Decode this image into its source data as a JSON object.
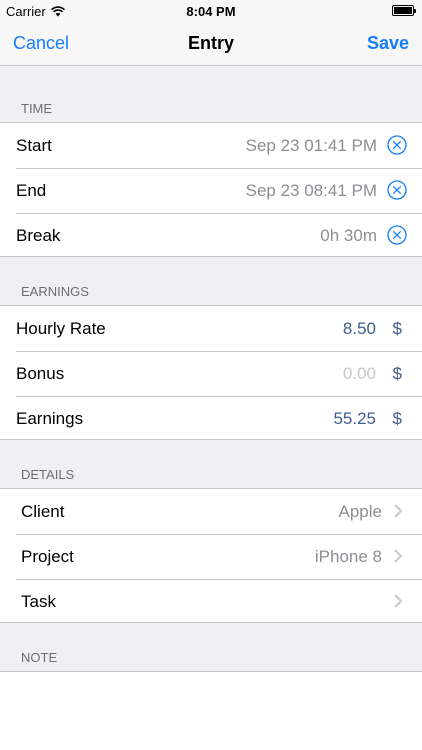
{
  "status_bar": {
    "carrier": "Carrier",
    "time": "8:04 PM"
  },
  "nav": {
    "cancel": "Cancel",
    "title": "Entry",
    "save": "Save"
  },
  "sections": {
    "time": {
      "header": "TIME",
      "rows": [
        {
          "label": "Start",
          "value": "Sep 23 01:41 PM"
        },
        {
          "label": "End",
          "value": "Sep 23 08:41 PM"
        },
        {
          "label": "Break",
          "value": "0h 30m"
        }
      ]
    },
    "earnings": {
      "header": "EARNINGS",
      "rows": [
        {
          "label": "Hourly Rate",
          "value": "8.50",
          "unit": "$"
        },
        {
          "label": "Bonus",
          "value": "0.00",
          "unit": "$"
        },
        {
          "label": "Earnings",
          "value": "55.25",
          "unit": "$"
        }
      ]
    },
    "details": {
      "header": "DETAILS",
      "rows": [
        {
          "label": "Client",
          "value": "Apple"
        },
        {
          "label": "Project",
          "value": "iPhone 8"
        },
        {
          "label": "Task",
          "value": ""
        }
      ]
    },
    "note": {
      "header": "NOTE"
    }
  },
  "colors": {
    "accent": "#157efb",
    "value_blue": "#3f5e8e",
    "separator": "#c8c7cc",
    "background": "#efeff4"
  }
}
